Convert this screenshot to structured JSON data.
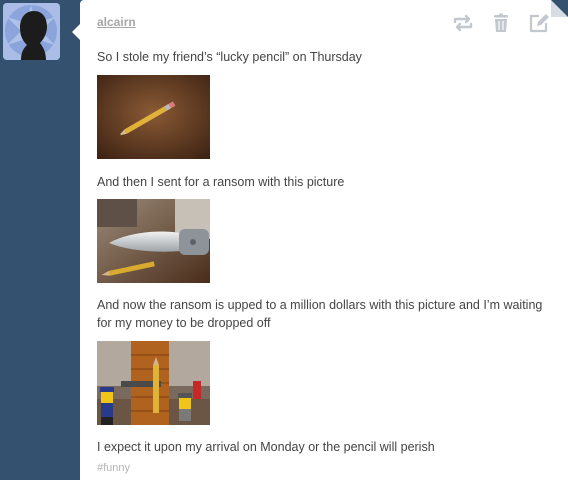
{
  "post": {
    "author": "alcairn",
    "paragraphs": [
      "So I stole my friend’s “lucky pencil” on Thursday",
      "And then I sent for a ransom with this picture",
      "And now the ransom is upped to a million dollars with this picture and I’m waiting for my money to be dropped off",
      "I expect it upon my arrival on Monday or the pencil will perish"
    ],
    "tag": "#funny",
    "controls": [
      "reblog-icon",
      "trash-icon",
      "edit-icon"
    ]
  },
  "colors": {
    "dashboard_bg": "#34526f",
    "post_bg": "#ffffff",
    "text": "#444444",
    "muted": "#a7a7a7",
    "icon": "#c3c8ce"
  }
}
